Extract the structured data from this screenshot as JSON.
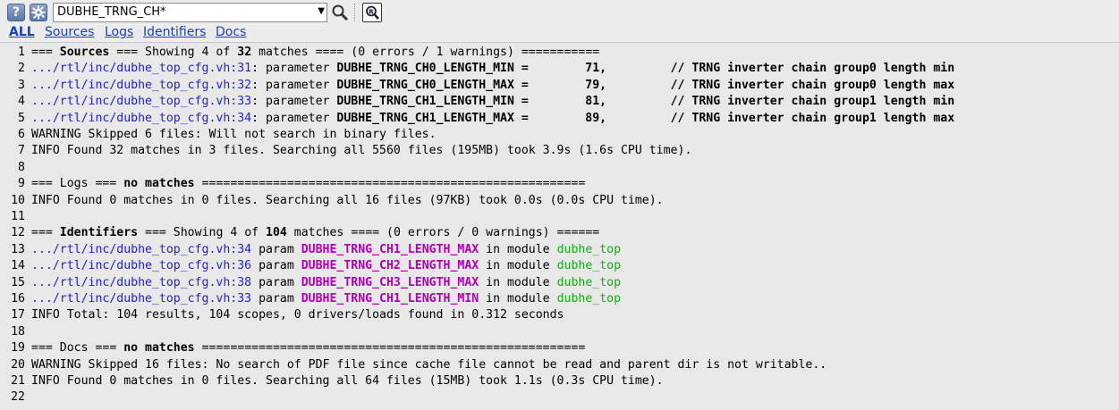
{
  "toolbar": {
    "help_label": "?",
    "settings_icon": "gear-icon",
    "query_value": "DUBHE_TRNG_CH*",
    "search_icon": "magnifier-icon",
    "refine_icon": "magnifier-refine-icon"
  },
  "filters": [
    "ALL",
    "Sources",
    "Logs",
    "Identifiers",
    "Docs"
  ],
  "colors": {
    "link": "#2222cc",
    "identifier": "#b400b4",
    "module": "#1aa81a"
  },
  "lines": [
    {
      "n": "1",
      "parts": [
        [
          "",
          "=== "
        ],
        [
          "b",
          "Sources"
        ],
        [
          "",
          " === Showing 4 of "
        ],
        [
          "b",
          "32"
        ],
        [
          "",
          " matches ==== (0 errors / 1 warnings) ==========="
        ]
      ]
    },
    {
      "n": "2",
      "parts": [
        [
          "lnk",
          ".../rtl/inc/dubhe_top_cfg.vh:31"
        ],
        [
          "",
          ": parameter "
        ],
        [
          "b",
          "DUBHE_TRNG_CH0_LENGTH_MIN =        71,         // TRNG inverter chain group0 length min"
        ]
      ]
    },
    {
      "n": "3",
      "parts": [
        [
          "lnk",
          ".../rtl/inc/dubhe_top_cfg.vh:32"
        ],
        [
          "",
          ": parameter "
        ],
        [
          "b",
          "DUBHE_TRNG_CH0_LENGTH_MAX =        79,         // TRNG inverter chain group0 length max"
        ]
      ]
    },
    {
      "n": "4",
      "parts": [
        [
          "lnk",
          ".../rtl/inc/dubhe_top_cfg.vh:33"
        ],
        [
          "",
          ": parameter "
        ],
        [
          "b",
          "DUBHE_TRNG_CH1_LENGTH_MIN =        81,         // TRNG inverter chain group1 length min"
        ]
      ]
    },
    {
      "n": "5",
      "parts": [
        [
          "lnk",
          ".../rtl/inc/dubhe_top_cfg.vh:34"
        ],
        [
          "",
          ": parameter "
        ],
        [
          "b",
          "DUBHE_TRNG_CH1_LENGTH_MAX =        89,         // TRNG inverter chain group1 length max"
        ]
      ]
    },
    {
      "n": "6",
      "parts": [
        [
          "",
          "WARNING Skipped 6 files: Will not search in binary files."
        ]
      ]
    },
    {
      "n": "7",
      "parts": [
        [
          "",
          "INFO Found 32 matches in 3 files. Searching all 5560 files (195MB) took 3.9s (1.6s CPU time)."
        ]
      ]
    },
    {
      "n": "8",
      "parts": []
    },
    {
      "n": "9",
      "parts": [
        [
          "",
          "=== Logs === "
        ],
        [
          "b",
          "no matches"
        ],
        [
          "",
          " ======================================================"
        ]
      ]
    },
    {
      "n": "10",
      "parts": [
        [
          "",
          "INFO Found 0 matches in 0 files. Searching all 16 files (97KB) took 0.0s (0.0s CPU time)."
        ]
      ]
    },
    {
      "n": "11",
      "parts": []
    },
    {
      "n": "12",
      "parts": [
        [
          "",
          "=== "
        ],
        [
          "b",
          "Identifiers"
        ],
        [
          "",
          " === Showing 4 of "
        ],
        [
          "b",
          "104"
        ],
        [
          "",
          " matches ==== (0 errors / 0 warnings) ======"
        ]
      ]
    },
    {
      "n": "13",
      "parts": [
        [
          "lnk",
          ".../rtl/inc/dubhe_top_cfg.vh:34"
        ],
        [
          "",
          " param "
        ],
        [
          "id",
          "DUBHE_TRNG_CH1_LENGTH_MAX"
        ],
        [
          "",
          " in module "
        ],
        [
          "mod",
          "dubhe_top"
        ]
      ]
    },
    {
      "n": "14",
      "parts": [
        [
          "lnk",
          ".../rtl/inc/dubhe_top_cfg.vh:36"
        ],
        [
          "",
          " param "
        ],
        [
          "id",
          "DUBHE_TRNG_CH2_LENGTH_MAX"
        ],
        [
          "",
          " in module "
        ],
        [
          "mod",
          "dubhe_top"
        ]
      ]
    },
    {
      "n": "15",
      "parts": [
        [
          "lnk",
          ".../rtl/inc/dubhe_top_cfg.vh:38"
        ],
        [
          "",
          " param "
        ],
        [
          "id",
          "DUBHE_TRNG_CH3_LENGTH_MAX"
        ],
        [
          "",
          " in module "
        ],
        [
          "mod",
          "dubhe_top"
        ]
      ]
    },
    {
      "n": "16",
      "parts": [
        [
          "lnk",
          ".../rtl/inc/dubhe_top_cfg.vh:33"
        ],
        [
          "",
          " param "
        ],
        [
          "id",
          "DUBHE_TRNG_CH1_LENGTH_MIN"
        ],
        [
          "",
          " in module "
        ],
        [
          "mod",
          "dubhe_top"
        ]
      ]
    },
    {
      "n": "17",
      "parts": [
        [
          "",
          "INFO Total: 104 results, 104 scopes, 0 drivers/loads found in 0.312 seconds"
        ]
      ]
    },
    {
      "n": "18",
      "parts": []
    },
    {
      "n": "19",
      "parts": [
        [
          "",
          "=== Docs === "
        ],
        [
          "b",
          "no matches"
        ],
        [
          "",
          " ======================================================"
        ]
      ]
    },
    {
      "n": "20",
      "parts": [
        [
          "",
          "WARNING Skipped 16 files: No search of PDF file since cache file cannot be read and parent dir is not writable.."
        ]
      ]
    },
    {
      "n": "21",
      "parts": [
        [
          "",
          "INFO Found 0 matches in 0 files. Searching all 64 files (15MB) took 1.1s (0.3s CPU time)."
        ]
      ]
    },
    {
      "n": "22",
      "parts": []
    }
  ]
}
